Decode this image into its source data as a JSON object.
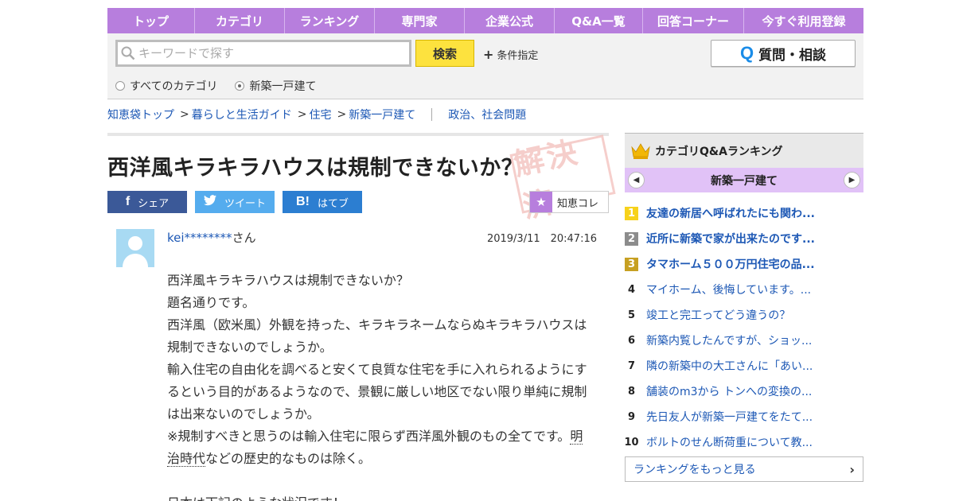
{
  "nav": [
    {
      "label": "トップ"
    },
    {
      "label": "カテゴリ"
    },
    {
      "label": "ランキング"
    },
    {
      "label": "専門家"
    },
    {
      "label": "企業公式"
    },
    {
      "label": "Q&A一覧"
    },
    {
      "label": "回答コーナー"
    },
    {
      "label": "今すぐ利用登録"
    }
  ],
  "search": {
    "placeholder": "キーワードで探す",
    "button": "検索",
    "condition": "条件指定",
    "ask_button": "質問・相談",
    "ask_icon": "Q",
    "scope_all": "すべてのカテゴリ",
    "scope_current": "新築一戸建て"
  },
  "breadcrumb": {
    "items": [
      "知恵袋トップ",
      "暮らしと生活ガイド",
      "住宅",
      "新築一戸建て"
    ],
    "separator": ">",
    "related": "政治、社会問題"
  },
  "question": {
    "title": "西洋風キラキラハウスは規制できないか？",
    "stamp": "解決済",
    "user": "kei********",
    "user_suffix": "さん",
    "datetime": "2019/3/11　20:47:16",
    "lines": [
      "西洋風キラキラハウスは規制できないか？",
      "題名通りです。",
      "西洋風（欧米風）外観を持った、キラキラネームならぬキラキラハウスは規制できないのでしょうか。",
      "輸入住宅の自由化を調べると安くて良質な住宅を手に入れられるようにするという目的があるようなので、景観に厳しい地区でない限り単純に規制は出来ないのでしょうか。",
      "※規制すべきと思うのは輸入住宅に限らず西洋風外観のもの全てです。",
      "明治時代",
      "などの歴史的なものは除く。",
      "日本は下記のような状況です！"
    ]
  },
  "share": {
    "facebook": "シェア",
    "twitter": "ツイート",
    "hatena": "はてブ",
    "hatena_icon": "B!",
    "collect": "知恵コレ"
  },
  "sidebar": {
    "title": "カテゴリQ&Aランキング",
    "category": "新築一戸建て",
    "ranking": [
      {
        "rank": "1",
        "title": "友達の新居へ呼ばれたにも関わ..."
      },
      {
        "rank": "2",
        "title": "近所に新築で家が出来たのです..."
      },
      {
        "rank": "3",
        "title": "タマホーム５００万円住宅の品..."
      },
      {
        "rank": "4",
        "title": "マイホーム、後悔しています。..."
      },
      {
        "rank": "5",
        "title": "竣工と完工ってどう違うの？"
      },
      {
        "rank": "6",
        "title": "新築内覧したんですが、ショッ..."
      },
      {
        "rank": "7",
        "title": "隣の新築中の大工さんに「あい..."
      },
      {
        "rank": "8",
        "title": "舗装のm3から トンへの変換の..."
      },
      {
        "rank": "9",
        "title": "先日友人が新築一戸建てをたて..."
      },
      {
        "rank": "10",
        "title": "ボルトのせん断荷重について教..."
      }
    ],
    "more": "ランキングをもっと見る"
  }
}
